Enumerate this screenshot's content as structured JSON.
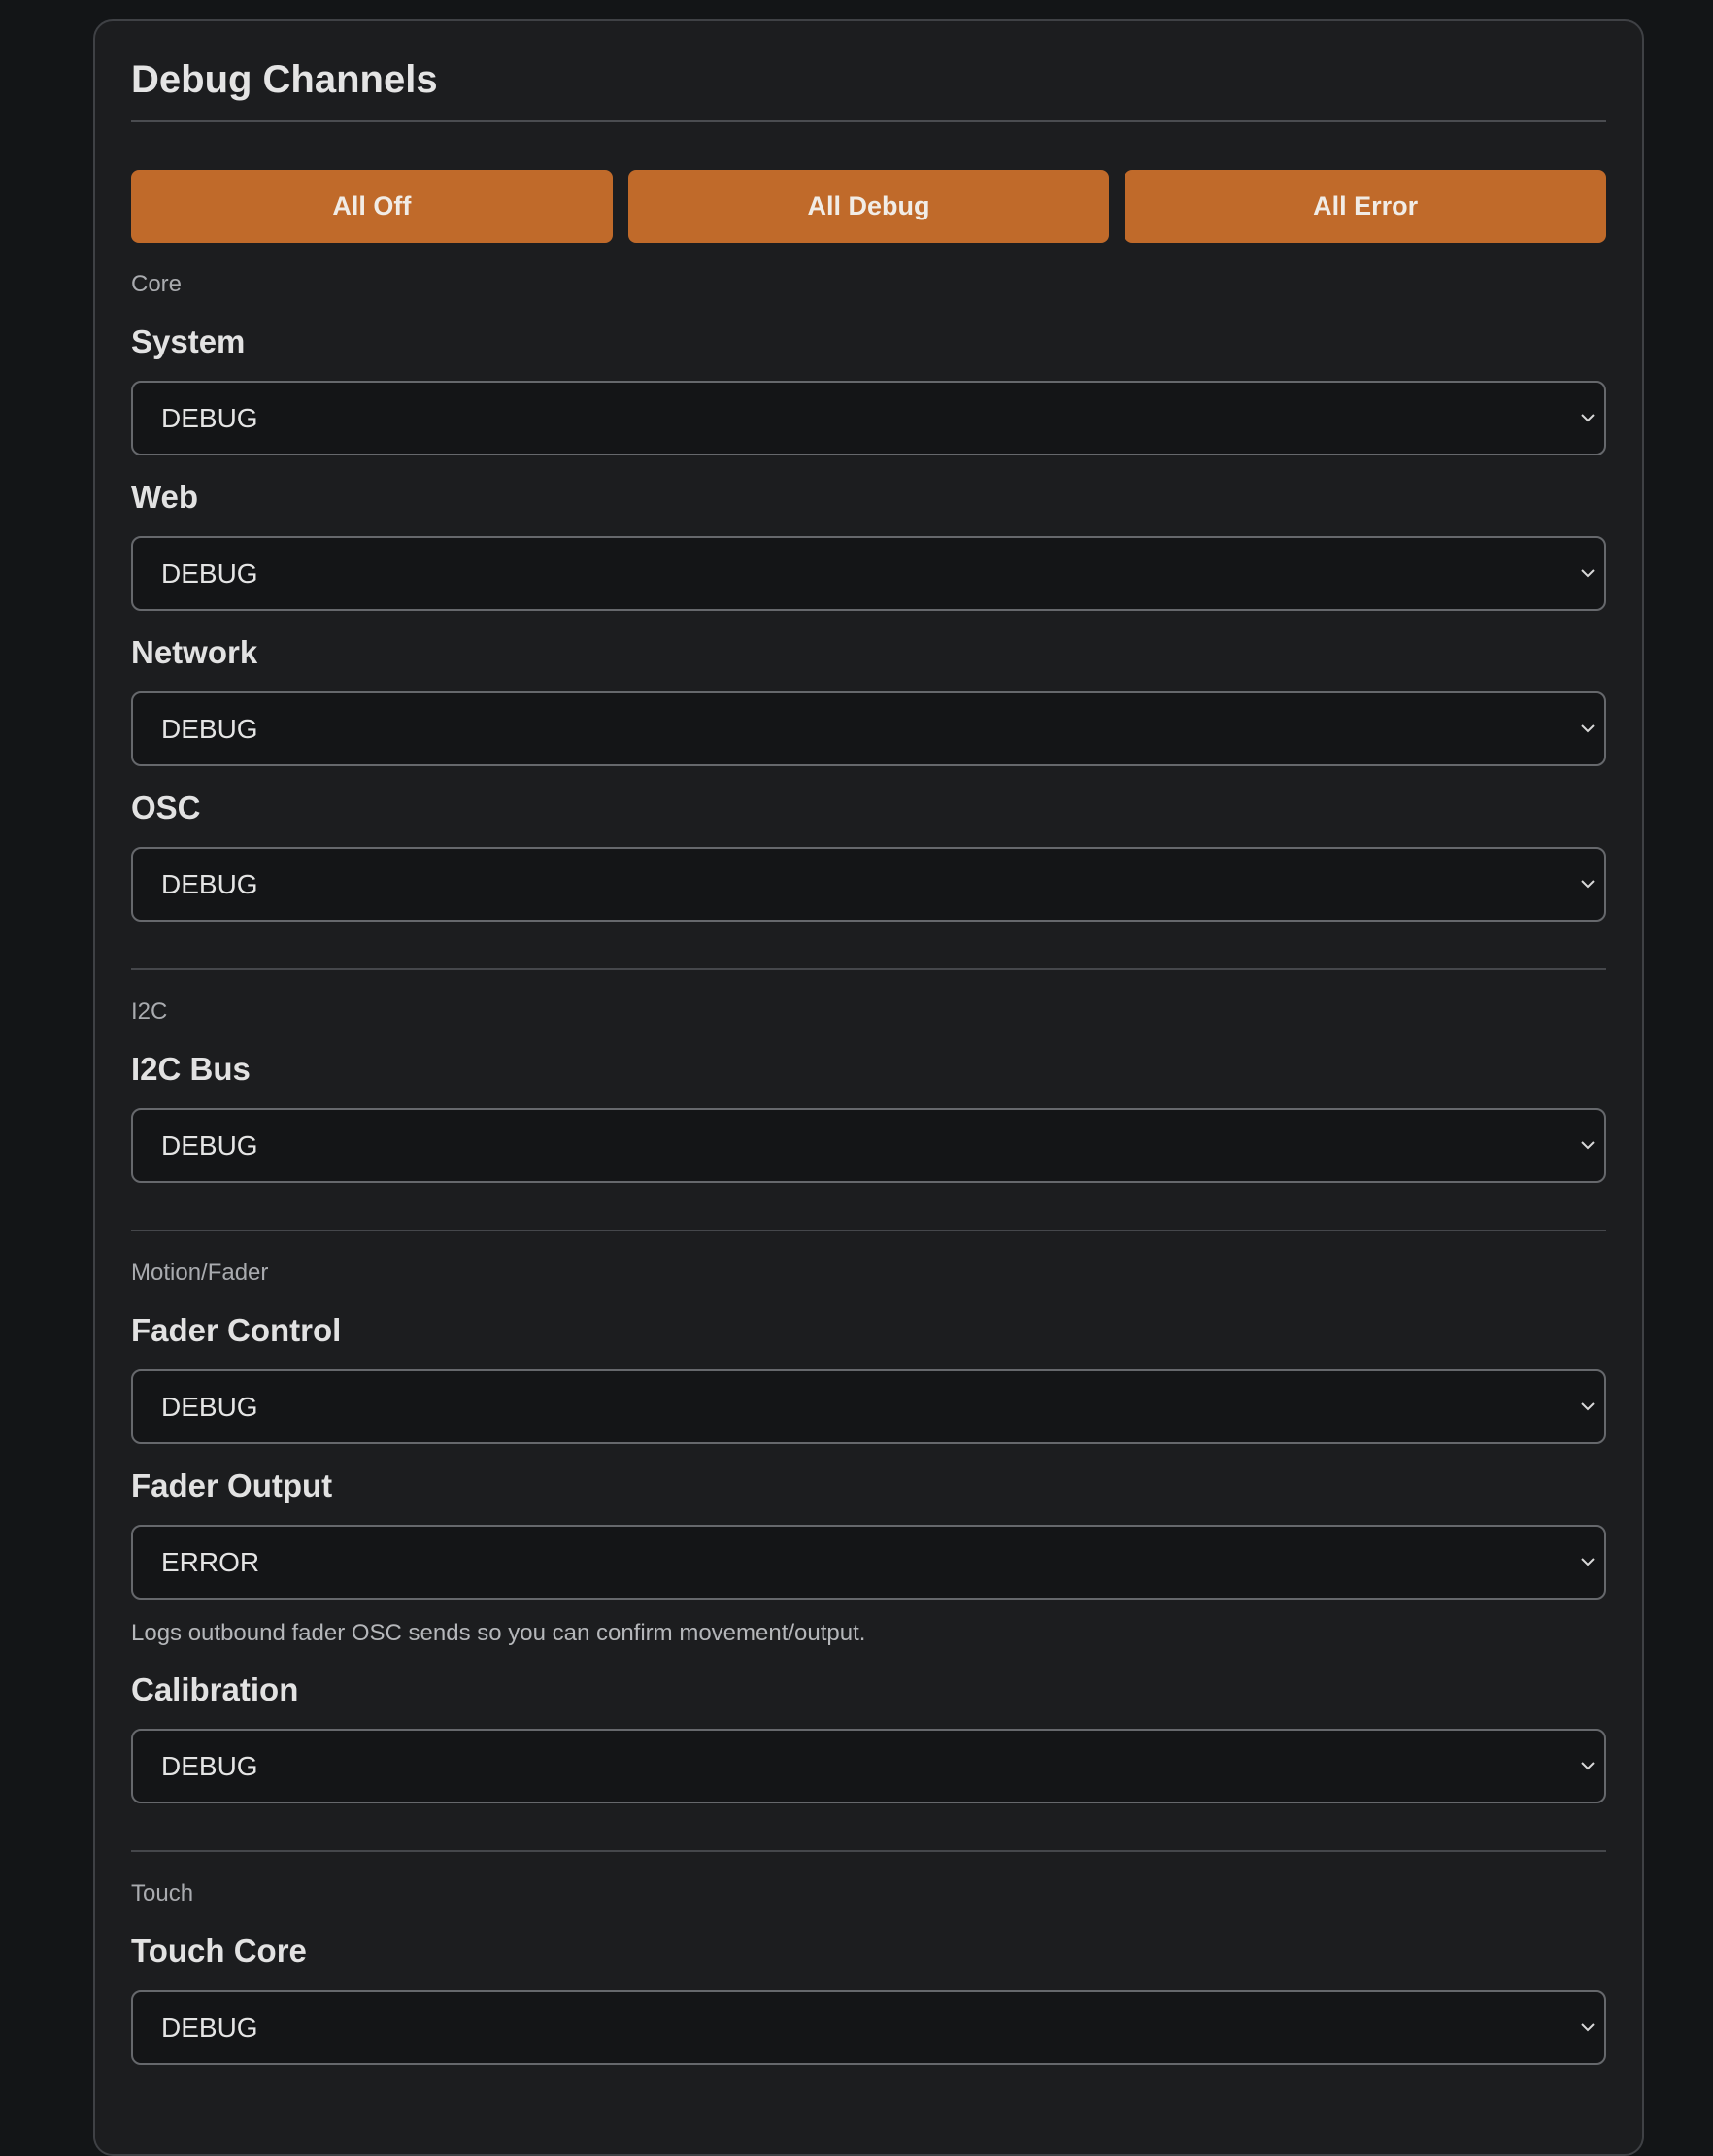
{
  "panel": {
    "title": "Debug Channels"
  },
  "actions": {
    "all_off": "All Off",
    "all_debug": "All Debug",
    "all_error": "All Error"
  },
  "sections": [
    {
      "label": "Core",
      "channels": [
        {
          "label": "System",
          "value": "DEBUG"
        },
        {
          "label": "Web",
          "value": "DEBUG"
        },
        {
          "label": "Network",
          "value": "DEBUG"
        },
        {
          "label": "OSC",
          "value": "DEBUG"
        }
      ]
    },
    {
      "label": "I2C",
      "channels": [
        {
          "label": "I2C Bus",
          "value": "DEBUG"
        }
      ]
    },
    {
      "label": "Motion/Fader",
      "channels": [
        {
          "label": "Fader Control",
          "value": "DEBUG"
        },
        {
          "label": "Fader Output",
          "value": "ERROR",
          "hint": "Logs outbound fader OSC sends so you can confirm movement/output."
        },
        {
          "label": "Calibration",
          "value": "DEBUG"
        }
      ]
    },
    {
      "label": "Touch",
      "channels": [
        {
          "label": "Touch Core",
          "value": "DEBUG"
        }
      ]
    }
  ],
  "icons": {
    "select_chevron": "chevron-down-icon"
  }
}
